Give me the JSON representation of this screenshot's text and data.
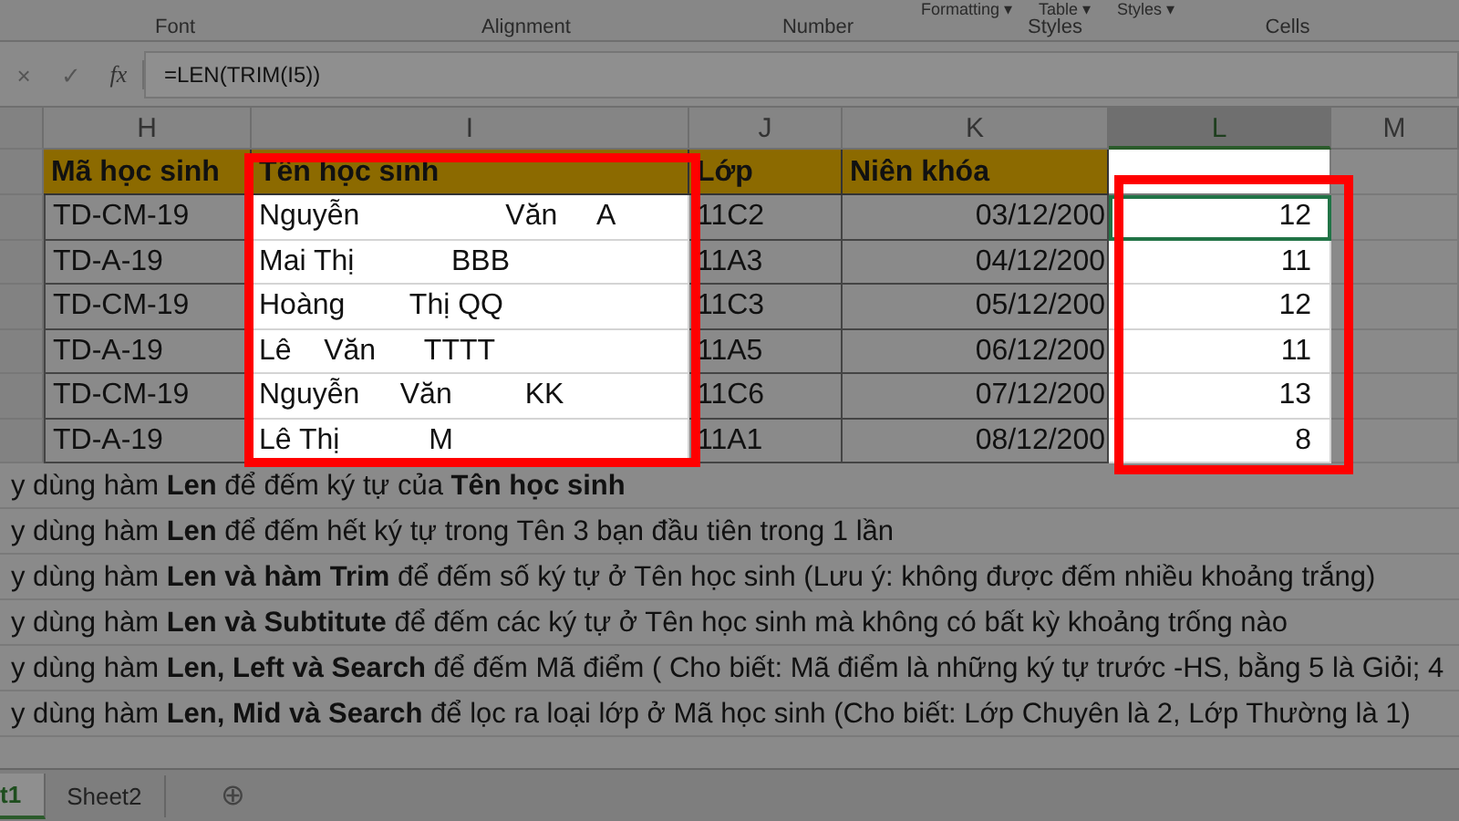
{
  "ribbon": {
    "partial_buttons": [
      "Formatting ▾",
      "Table ▾",
      "Styles ▾"
    ],
    "groups": [
      "Font",
      "Alignment",
      "Number",
      "Styles",
      "Cells"
    ]
  },
  "formula_bar": {
    "cancel": "×",
    "enter": "✓",
    "fx": "fx",
    "formula": "=LEN(TRIM(I5))"
  },
  "columns": [
    {
      "label": "H",
      "selected": false,
      "highlighted": false
    },
    {
      "label": "I",
      "selected": false,
      "highlighted": true
    },
    {
      "label": "J",
      "selected": false,
      "highlighted": false
    },
    {
      "label": "K",
      "selected": false,
      "highlighted": false
    },
    {
      "label": "L",
      "selected": true,
      "highlighted": true
    },
    {
      "label": "M",
      "selected": false,
      "highlighted": false
    }
  ],
  "header_row": [
    "Mã học sinh",
    "Tên học sinh",
    "Lớp",
    "Niên khóa"
  ],
  "rows": [
    {
      "cells": [
        "TD-CM-19",
        "Nguyễn                  Văn     A",
        "11C2",
        "03/12/200",
        "12"
      ],
      "selected": true
    },
    {
      "cells": [
        "TD-A-19",
        "Mai Thị            BBB",
        "11A3",
        "04/12/200",
        "11"
      ],
      "selected": false
    },
    {
      "cells": [
        "TD-CM-19",
        "Hoàng        Thị QQ",
        "11C3",
        "05/12/200",
        "12"
      ],
      "selected": false
    },
    {
      "cells": [
        "TD-A-19",
        "Lê    Văn      TTTT",
        "11A5",
        "06/12/200",
        "11"
      ],
      "selected": false
    },
    {
      "cells": [
        "TD-CM-19",
        "Nguyễn     Văn         KK",
        "11C6",
        "07/12/200",
        "13"
      ],
      "selected": false
    },
    {
      "cells": [
        "TD-A-19",
        "Lê Thị           M",
        "11A1",
        "08/12/200",
        "8"
      ],
      "selected": false
    }
  ],
  "instructions": [
    "y dùng hàm **Len** để đếm ký tự của **Tên học sinh**",
    "y dùng hàm **Len** để đếm hết ký tự trong Tên 3 bạn đầu tiên  trong 1 lần",
    "y dùng hàm **Len và hàm Trim** để đếm số ký tự ở Tên học sinh (Lưu ý: không được đếm nhiều khoảng trắng)",
    "y dùng hàm **Len và Subtitute** để đếm các ký tự ở Tên học sinh mà không có bất kỳ khoảng trống nào",
    "y dùng hàm **Len, Left và Search** để đếm Mã điểm ( Cho biết: Mã điểm là những ký tự trước -HS, bằng 5 là Giỏi; 4",
    "y dùng hàm **Len, Mid và Search** để lọc ra loại lớp ở Mã học sinh (Cho biết: Lớp Chuyên là 2, Lớp Thường là 1)"
  ],
  "sheet_tabs": [
    {
      "label": "t1",
      "selected": true
    },
    {
      "label": "Sheet2",
      "selected": false
    }
  ],
  "add_sheet": "⊕"
}
